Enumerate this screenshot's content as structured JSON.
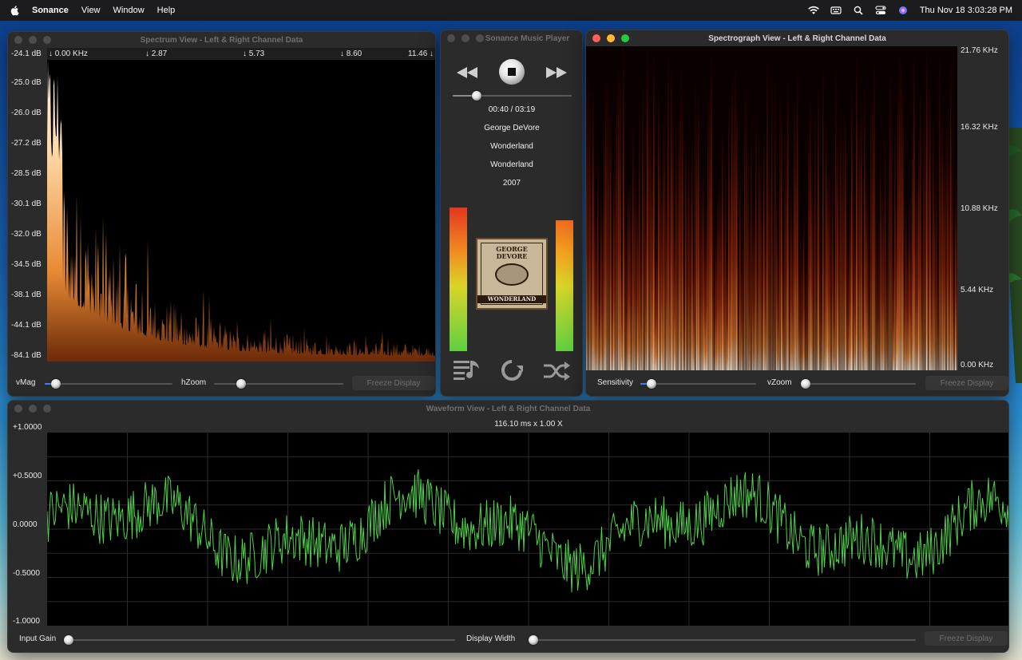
{
  "menubar": {
    "app_name": "Sonance",
    "menus": [
      "View",
      "Window",
      "Help"
    ],
    "clock": "Thu Nov 18  3:03:28 PM"
  },
  "spectrum": {
    "title": "Spectrum View - Left & Right Channel Data",
    "db_labels": [
      "-24.1 dB",
      "-25.0 dB",
      "-26.0 dB",
      "-27.2 dB",
      "-28.5 dB",
      "-30.1 dB",
      "-32.0 dB",
      "-34.5 dB",
      "-38.1 dB",
      "-44.1 dB",
      "-84.1 dB"
    ],
    "freq_labels": [
      "↓ 0.00 KHz",
      "↓ 2.87",
      "↓ 5.73",
      "↓ 8.60",
      "11.46 ↓"
    ],
    "vmag_label": "vMag",
    "hzoom_label": "hZoom",
    "freeze_label": "Freeze Display"
  },
  "player": {
    "title": "Sonance Music Player",
    "time": "00:40 / 03:19",
    "artist": "George DeVore",
    "album": "Wonderland",
    "track": "Wonderland",
    "year": "2007",
    "progress_fraction": 0.2,
    "album_art_text_top": "GEORGE DEVORE",
    "album_art_text_bottom": "WONDERLAND"
  },
  "spectrograph": {
    "title": "Spectrograph View - Left & Right Channel Data",
    "freq_labels": [
      "21.76 KHz",
      "16.32 KHz",
      "10.88 KHz",
      "5.44 KHz",
      "0.00 KHz"
    ],
    "sensitivity_label": "Sensitivity",
    "vzoom_label": "vZoom",
    "freeze_label": "Freeze Display"
  },
  "waveform": {
    "title": "Waveform View - Left & Right Channel Data",
    "scale_text": "116.10 ms x 1.00 X",
    "amp_labels": [
      "+1.0000",
      "+0.5000",
      "0.0000",
      "-0.5000",
      "-1.0000"
    ],
    "input_gain_label": "Input Gain",
    "display_width_label": "Display Width",
    "freeze_label": "Freeze Display"
  },
  "colors": {
    "waveform": "#4fd14a",
    "slider_accent": "#3a82f7",
    "window_bg": "#2b2b2b"
  }
}
